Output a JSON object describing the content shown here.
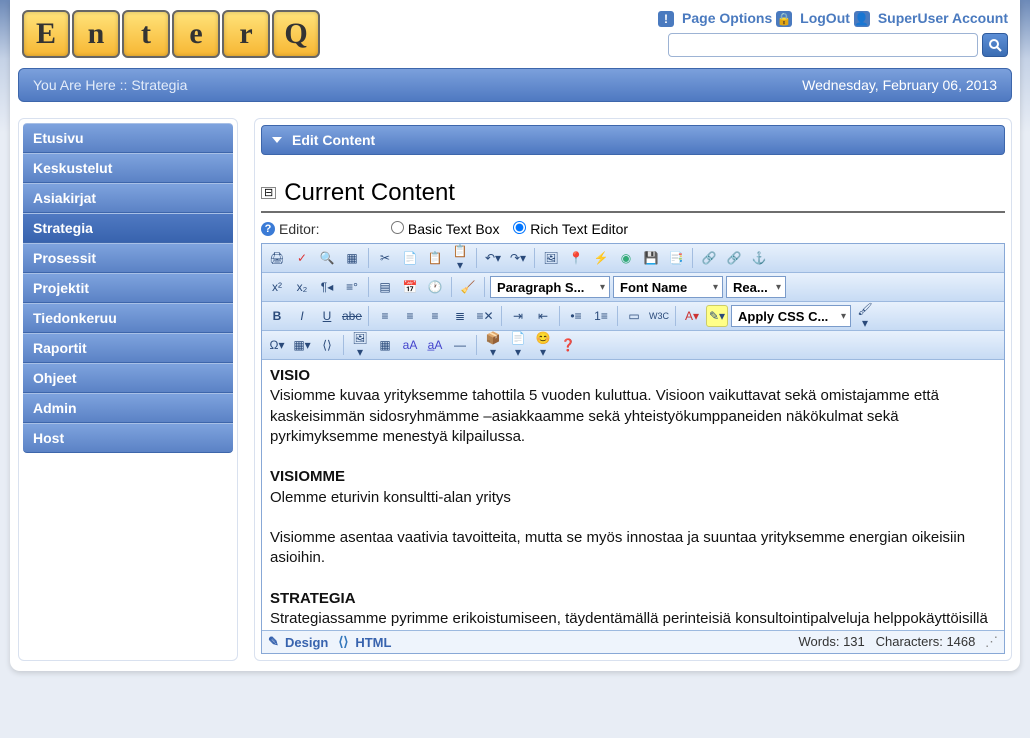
{
  "logo_letters": [
    "E",
    "n",
    "t",
    "e",
    "r",
    "Q"
  ],
  "toplinks": {
    "page_options": "Page Options",
    "logout": "LogOut",
    "account": "SuperUser Account"
  },
  "search": {
    "placeholder": ""
  },
  "breadcrumb": {
    "prefix": "You Are Here ::",
    "current": "Strategia",
    "date": "Wednesday, February 06, 2013"
  },
  "sidebar": {
    "items": [
      {
        "label": "Etusivu"
      },
      {
        "label": "Keskustelut"
      },
      {
        "label": "Asiakirjat"
      },
      {
        "label": "Strategia",
        "active": true
      },
      {
        "label": "Prosessit"
      },
      {
        "label": "Projektit"
      },
      {
        "label": "Tiedonkeruu"
      },
      {
        "label": "Raportit"
      },
      {
        "label": "Ohjeet"
      },
      {
        "label": "Admin"
      },
      {
        "label": "Host"
      }
    ]
  },
  "panel": {
    "title": "Edit Content"
  },
  "section": {
    "title": "Current Content"
  },
  "editor": {
    "label": "Editor:",
    "basic_label": "Basic Text Box",
    "rich_label": "Rich Text Editor",
    "paragraph": "Paragraph S...",
    "fontname": "Font Name",
    "realfont": "Rea...",
    "applycss": "Apply CSS C..."
  },
  "content": {
    "h1": "VISIO",
    "p1": "Visiomme kuvaa yrityksemme tahottila 5 vuoden kuluttua. Visioon vaikuttavat sekä omistajamme että kaskeisimmän sidosryhmämme –asiakkaamme sekä yhteistyökumppaneiden näkökulmat sekä pyrkimyksemme menestyä kilpailussa.",
    "h2": "VISIOMME",
    "p2": "Olemme eturivin konsultti-alan yritys",
    "p3": "Visiomme asentaa vaativia tavoitteita, mutta se myös innostaa ja suuntaa yrityksemme energian oikeisiin asioihin.",
    "h3": "STRATEGIA",
    "p4": "Strategiassamme pyrimme erikoistumiseen, täydentämällä perinteisiä konsultointipalveluja helppokäyttöisillä ohjelmistoilla ja käyttämällä Internetin ja multimedian tuomia mahdollisuuksia koulutuskäytössä."
  },
  "footer": {
    "design": "Design",
    "html": "HTML",
    "words_label": "Words:",
    "words": "131",
    "chars_label": "Characters:",
    "chars": "1468"
  }
}
